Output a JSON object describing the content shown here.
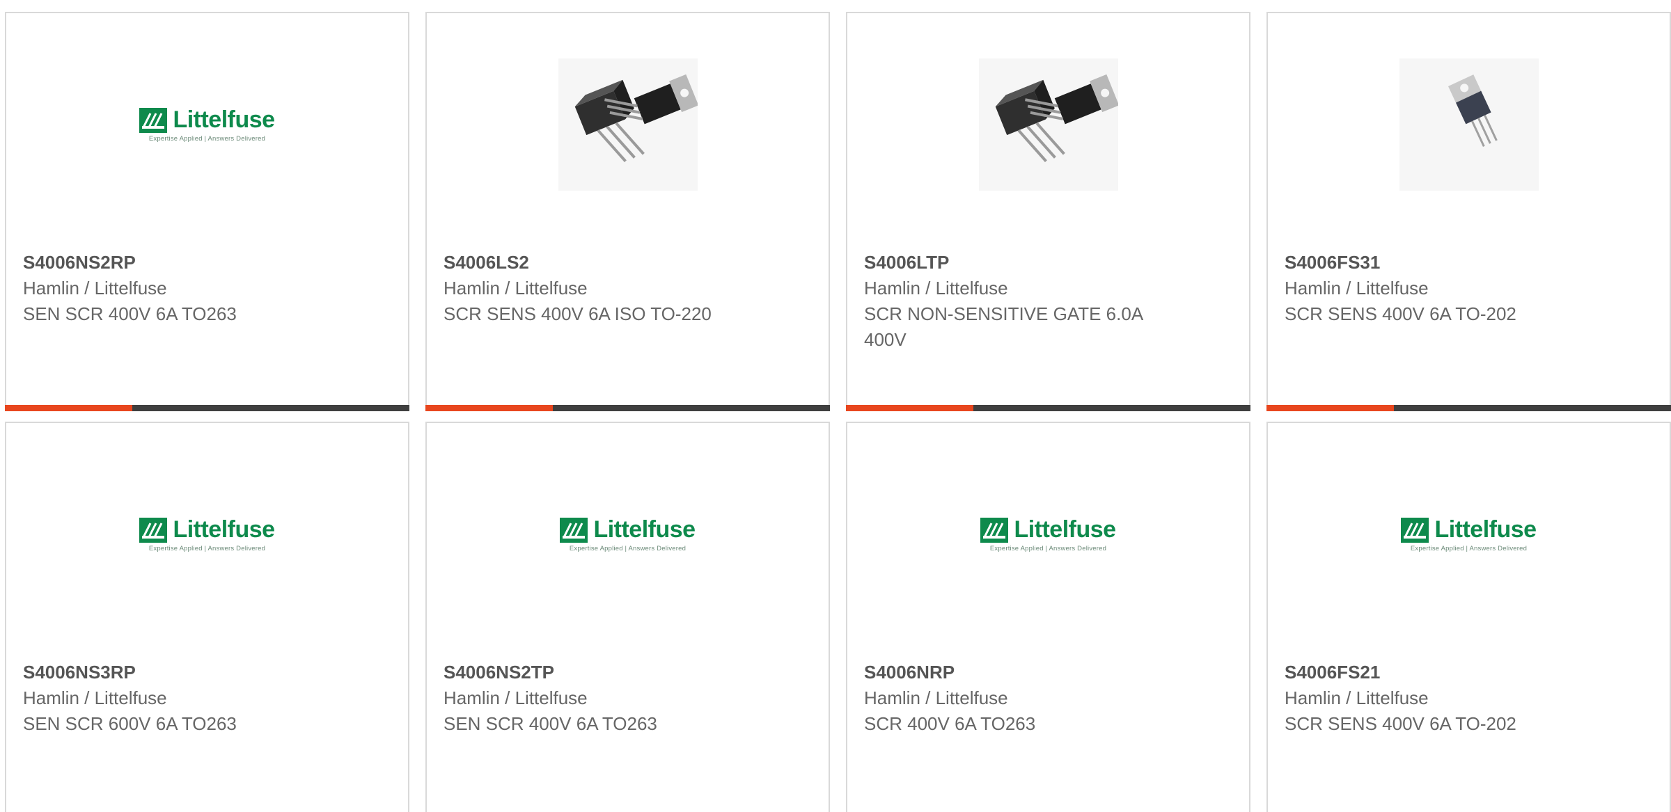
{
  "products": [
    {
      "part": "S4006NS2RP",
      "mfr": "Hamlin / Littelfuse",
      "desc": "SEN SCR 400V 6A TO263",
      "image": "littelfuse-logo"
    },
    {
      "part": "S4006LS2",
      "mfr": "Hamlin / Littelfuse",
      "desc": "SCR SENS 400V 6A ISO TO-220",
      "image": "to220-pair-photo"
    },
    {
      "part": "S4006LTP",
      "mfr": "Hamlin / Littelfuse",
      "desc": "SCR NON-SENSITIVE GATE 6.0A 400V",
      "image": "to220-pair-photo"
    },
    {
      "part": "S4006FS31",
      "mfr": "Hamlin / Littelfuse",
      "desc": "SCR SENS 400V 6A TO-202",
      "image": "to202-photo"
    },
    {
      "part": "S4006NS3RP",
      "mfr": "Hamlin / Littelfuse",
      "desc": "SEN SCR 600V 6A TO263",
      "image": "littelfuse-logo"
    },
    {
      "part": "S4006NS2TP",
      "mfr": "Hamlin / Littelfuse",
      "desc": "SEN SCR 400V 6A TO263",
      "image": "littelfuse-logo"
    },
    {
      "part": "S4006NRP",
      "mfr": "Hamlin / Littelfuse",
      "desc": "SCR 400V 6A TO263",
      "image": "littelfuse-logo"
    },
    {
      "part": "S4006FS21",
      "mfr": "Hamlin / Littelfuse",
      "desc": "SCR SENS 400V 6A TO-202",
      "image": "littelfuse-logo"
    }
  ],
  "logo": {
    "word": "Littelfuse",
    "tagline": "Expertise Applied | Answers Delivered"
  },
  "colors": {
    "accent": "#e8461e",
    "bar_dark": "#3f3f3f",
    "brand_green": "#0e8a4c",
    "border": "#d9d9d9",
    "text": "#666666"
  }
}
